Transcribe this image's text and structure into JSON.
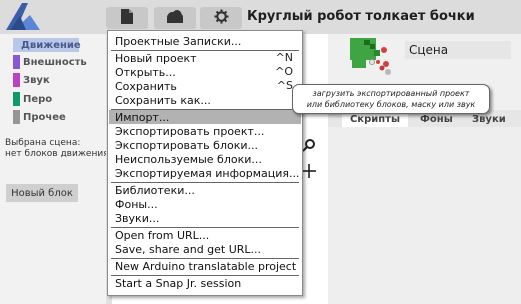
{
  "app": {
    "project_title": "Круглый робот толкает бочки",
    "toolbar_icons": [
      "file-icon",
      "cloud-icon",
      "gear-icon"
    ]
  },
  "palette": {
    "categories": [
      {
        "label": "Движение",
        "color": "#4a6cd4",
        "selected": true
      },
      {
        "label": "Внешность",
        "color": "#8a55d7"
      },
      {
        "label": "Звук",
        "color": "#bb42c3"
      },
      {
        "label": "Перо",
        "color": "#0e9a6c"
      },
      {
        "label": "Прочее",
        "color": "#969696"
      }
    ],
    "selected_sprite_line1": "Выбрана сцена:",
    "selected_sprite_line2": "нет блоков движения",
    "new_block": "Новый блок"
  },
  "file_menu": {
    "items": [
      {
        "label": "Проектные Записки..."
      },
      {
        "label": "Новый проект",
        "shortcut": "^N"
      },
      {
        "label": "Открыть...",
        "shortcut": "^O"
      },
      {
        "label": "Сохранить",
        "shortcut": "^S"
      },
      {
        "label": "Сохранить как..."
      },
      {
        "label": "Импорт...",
        "highlighted": true
      },
      {
        "label": "Экспортировать проект..."
      },
      {
        "label": "Экспортировать блоки..."
      },
      {
        "label": "Неиспользуемые блоки..."
      },
      {
        "label": "Экспортируемая информация..."
      },
      {
        "label": "Библиотеки..."
      },
      {
        "label": "Фоны..."
      },
      {
        "label": "Звуки..."
      },
      {
        "label": "Open from URL..."
      },
      {
        "label": "Save, share and get URL..."
      },
      {
        "label": "New Arduino translatable project"
      },
      {
        "label": "Start a Snap Jr. session"
      }
    ]
  },
  "tooltip": {
    "line1": "загрузить экспортированный проект",
    "line2": "или библиотеку блоков, маску или звук"
  },
  "sprite": {
    "name": "Сцена"
  },
  "tabs": [
    "Скрипты",
    "Фоны",
    "Звуки"
  ]
}
